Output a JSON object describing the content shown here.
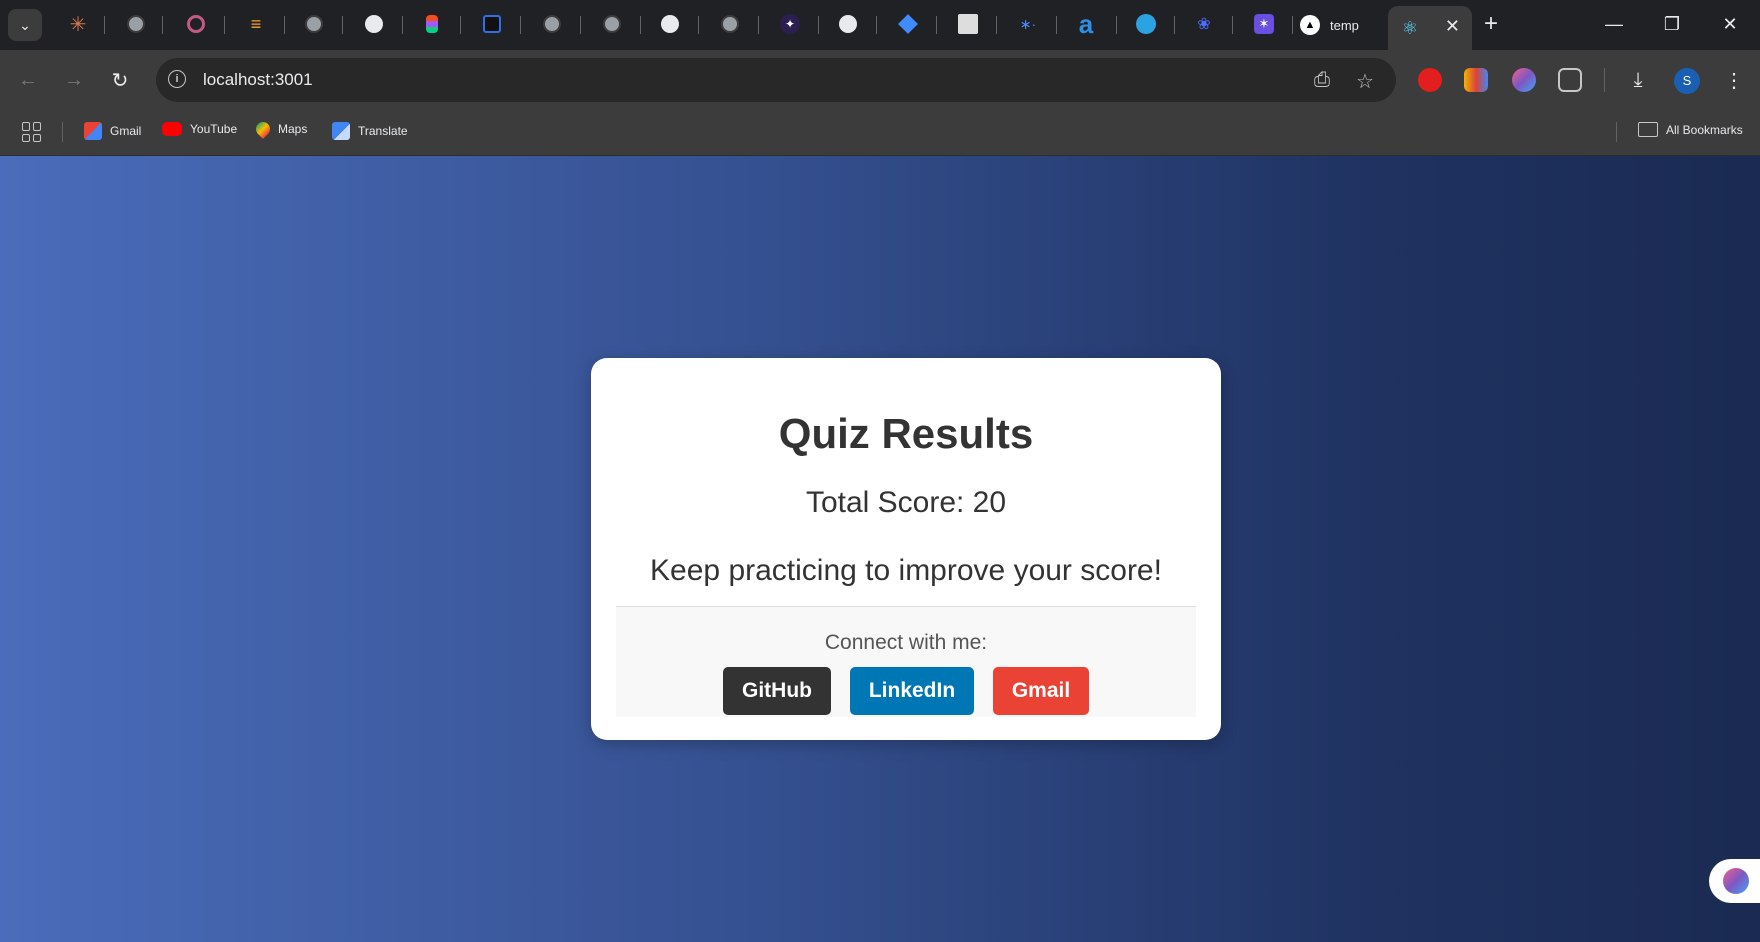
{
  "browser": {
    "active_tab_title": "temp",
    "url": "localhost:3001",
    "bookmarks": [
      {
        "label": "Gmail",
        "icon": "gmail-icon"
      },
      {
        "label": "YouTube",
        "icon": "youtube-icon"
      },
      {
        "label": "Maps",
        "icon": "maps-icon"
      },
      {
        "label": "Translate",
        "icon": "translate-icon"
      }
    ],
    "all_bookmarks_label": "All Bookmarks",
    "profile_initial": "S"
  },
  "quiz": {
    "title": "Quiz Results",
    "score_text": "Total Score: 20",
    "message": "Keep practicing to improve your score!"
  },
  "social": {
    "label": "Connect with me:",
    "buttons": [
      {
        "label": "GitHub",
        "color": "#333333"
      },
      {
        "label": "LinkedIn",
        "color": "#0077b5"
      },
      {
        "label": "Gmail",
        "color": "#ea4335"
      }
    ]
  },
  "colors": {
    "background_left": "#4a6cba",
    "background_right": "#1a2a52",
    "card": "#ffffff"
  }
}
